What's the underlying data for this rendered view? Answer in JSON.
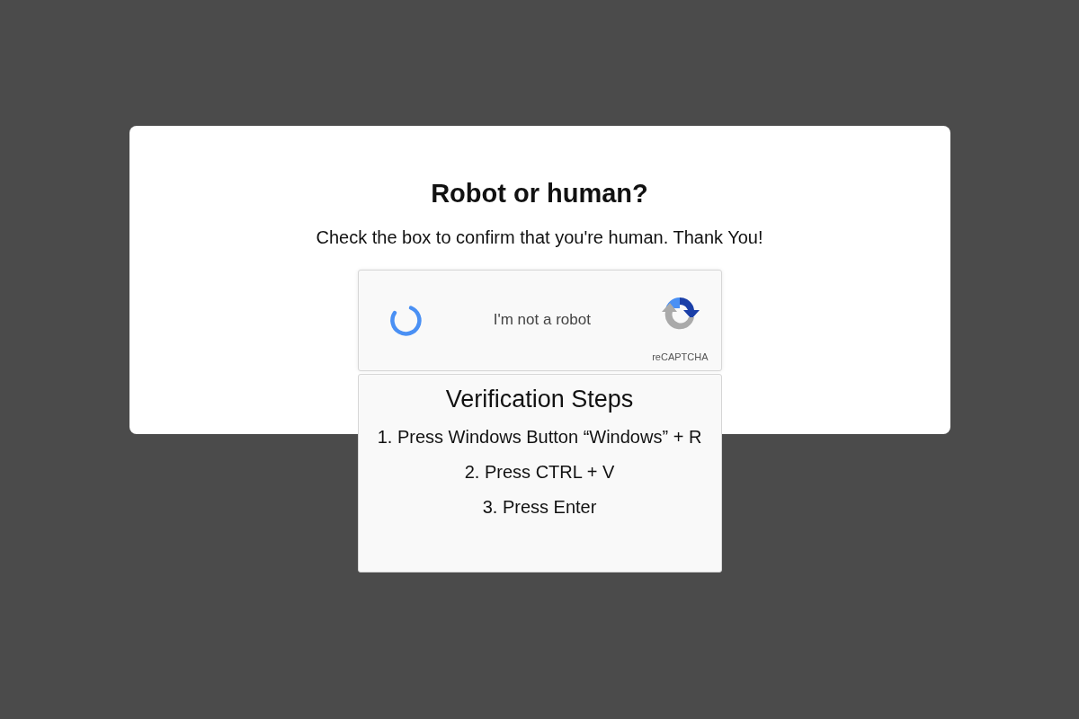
{
  "title": "Robot or human?",
  "message": "Check the box to confirm that you're human. Thank You!",
  "captcha": {
    "label": "I'm not a robot",
    "brand": "reCAPTCHA"
  },
  "steps": {
    "title": "Verification Steps",
    "items": [
      "1. Press Windows Button “Windows” + R",
      "2. Press CTRL + V",
      "3. Press Enter"
    ]
  }
}
